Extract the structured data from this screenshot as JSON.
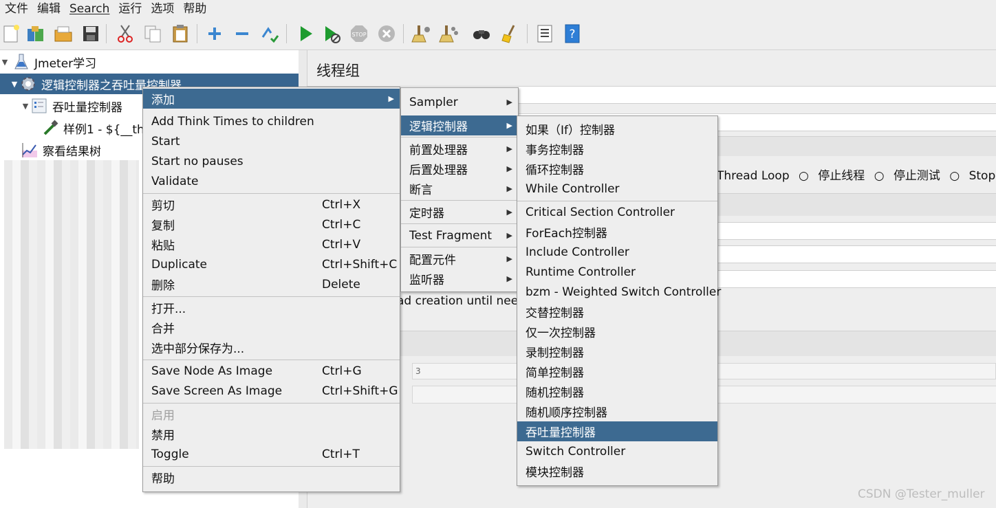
{
  "menubar": {
    "items": [
      "文件",
      "编辑",
      "Search",
      "运行",
      "选项",
      "帮助"
    ]
  },
  "toolbar": {
    "icons": [
      "new-icon",
      "templates-icon",
      "open-icon",
      "save-icon",
      "cut-icon",
      "copy-icon",
      "paste-icon",
      "expand-icon",
      "collapse-icon",
      "toggle-icon",
      "start-icon",
      "start-no-pauses-icon",
      "stop-icon",
      "shutdown-icon",
      "clear-icon",
      "clear-all-icon",
      "search-icon",
      "reset-search-icon",
      "function-helper-icon",
      "help-icon"
    ]
  },
  "tree": {
    "root": "Jmeter学习",
    "thread_group": "逻辑控制器之吞吐量控制器",
    "throughput_controller": "吞吐量控制器",
    "sampler": "样例1 - ${__th",
    "listener": "察看结果树"
  },
  "panel": {
    "title": "线程组",
    "radio_options": [
      "Thread Loop",
      "停止线程",
      "停止测试",
      "Stop Test"
    ],
    "creation_text": "ad creation until neede",
    "small_value": "3"
  },
  "context_menu": {
    "add": "添加",
    "add_think_times": "Add Think Times to children",
    "start": "Start",
    "start_no_pauses": "Start no pauses",
    "validate": "Validate",
    "cut": "剪切",
    "cut_sc": "Ctrl+X",
    "copy": "复制",
    "copy_sc": "Ctrl+C",
    "paste": "粘贴",
    "paste_sc": "Ctrl+V",
    "duplicate": "Duplicate",
    "duplicate_sc": "Ctrl+Shift+C",
    "delete": "删除",
    "delete_sc": "Delete",
    "open": "打开...",
    "merge": "合并",
    "save_selection": "选中部分保存为...",
    "save_node_image": "Save Node As Image",
    "save_node_image_sc": "Ctrl+G",
    "save_screen_image": "Save Screen As Image",
    "save_screen_image_sc": "Ctrl+Shift+G",
    "enable": "启用",
    "disable": "禁用",
    "toggle": "Toggle",
    "toggle_sc": "Ctrl+T",
    "help": "帮助"
  },
  "add_submenu": {
    "sampler": "Sampler",
    "logic_controller": "逻辑控制器",
    "pre_processor": "前置处理器",
    "post_processor": "后置处理器",
    "assertion": "断言",
    "timer": "定时器",
    "test_fragment": "Test Fragment",
    "config_element": "配置元件",
    "listener": "监听器"
  },
  "logic_submenu": {
    "if": "如果（If）控制器",
    "transaction": "事务控制器",
    "loop": "循环控制器",
    "while": "While Controller",
    "critical": "Critical Section Controller",
    "foreach": "ForEach控制器",
    "include": "Include Controller",
    "runtime": "Runtime Controller",
    "bzm": "bzm - Weighted Switch Controller",
    "interleave": "交替控制器",
    "once_only": "仅一次控制器",
    "recording": "录制控制器",
    "simple": "简单控制器",
    "random": "随机控制器",
    "random_order": "随机顺序控制器",
    "throughput": "吞吐量控制器",
    "switch": "Switch Controller",
    "module": "模块控制器"
  },
  "watermark": "CSDN @Tester_muller",
  "colors": {
    "selection": "#3d6a91",
    "menu_bg": "#eeeeee",
    "start_green": "#1e9b2f"
  }
}
